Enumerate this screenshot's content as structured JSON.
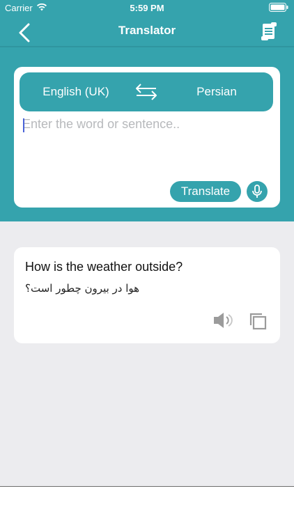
{
  "status_bar": {
    "carrier": "Carrier",
    "time": "5:59 PM",
    "wifi_icon": "wifi-icon",
    "battery_icon": "battery-icon"
  },
  "nav": {
    "title": "Translator",
    "back_icon": "chevron-left-icon",
    "history_icon": "history-scroll-icon"
  },
  "language_bar": {
    "source_language": "English (UK)",
    "target_language": "Persian",
    "swap_icon": "swap-arrows-icon"
  },
  "input": {
    "placeholder": "Enter the word or sentence..",
    "value": ""
  },
  "actions": {
    "translate_label": "Translate",
    "mic_icon": "microphone-icon"
  },
  "result": {
    "source_text": "How is the weather outside?",
    "translated_text": "هوا در بیرون چطور است؟",
    "speaker_icon": "speaker-icon",
    "copy_icon": "copy-icon"
  },
  "colors": {
    "accent": "#35a3ad",
    "background": "#ececef",
    "card": "#ffffff",
    "placeholder": "#b7b9bc",
    "icon_gray": "#9b9b9b"
  }
}
